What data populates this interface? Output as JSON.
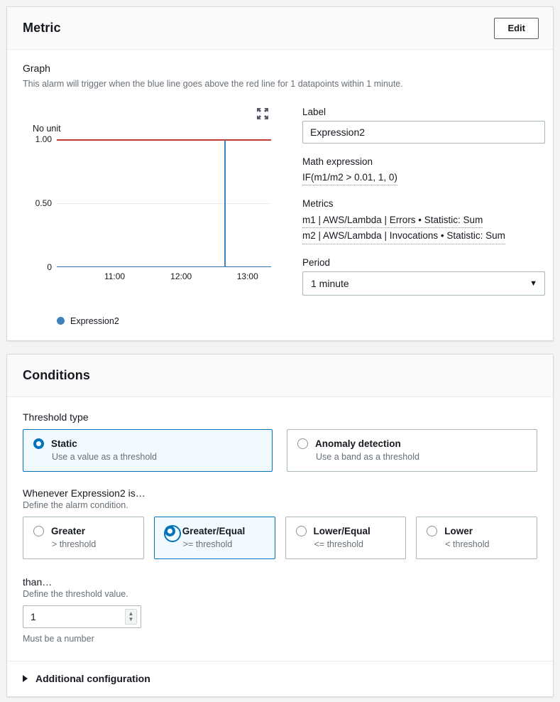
{
  "metric_card": {
    "title": "Metric",
    "edit_button": "Edit",
    "graph": {
      "heading": "Graph",
      "description": "This alarm will trigger when the blue line goes above the red line for 1 datapoints within 1 minute.",
      "expand_icon": "expand-icon",
      "unit_label": "No unit"
    },
    "fields": {
      "label_label": "Label",
      "label_value": "Expression2",
      "math_expression_label": "Math expression",
      "math_expression_value": "IF(m1/m2 > 0.01, 1, 0)",
      "metrics_label": "Metrics",
      "metrics_values": [
        "m1 | AWS/Lambda | Errors • Statistic: Sum",
        "m2 | AWS/Lambda | Invocations • Statistic: Sum"
      ],
      "period_label": "Period",
      "period_value": "1 minute"
    }
  },
  "chart_data": {
    "type": "line",
    "title": "",
    "xlabel": "",
    "ylabel": "No unit",
    "ylim": [
      0,
      1.0
    ],
    "yticks": [
      "1.00",
      "0.50",
      "0"
    ],
    "ytick_values": [
      1.0,
      0.5,
      0
    ],
    "xticks": [
      "11:00",
      "12:00",
      "13:00"
    ],
    "xtick_positions_pct": [
      27,
      58,
      89
    ],
    "grid": true,
    "legend": [
      {
        "name": "Expression2",
        "color": "#3d82bf"
      }
    ],
    "series": [
      {
        "name": "Expression2",
        "color": "#3d82bf",
        "x": [
          "10:30",
          "12:36",
          "12:37",
          "12:38",
          "13:30"
        ],
        "values": [
          0,
          0,
          1,
          0,
          0
        ]
      }
    ],
    "annotations": [
      {
        "type": "threshold-line",
        "label": "Threshold",
        "value": 1.0,
        "color": "#c03b2b"
      }
    ],
    "spike_position_pct": 78
  },
  "conditions_card": {
    "title": "Conditions",
    "threshold_type": {
      "label": "Threshold type",
      "options": [
        {
          "title": "Static",
          "desc": "Use a value as a threshold",
          "selected": true
        },
        {
          "title": "Anomaly detection",
          "desc": "Use a band as a threshold",
          "selected": false
        }
      ]
    },
    "whenever": {
      "label": "Whenever Expression2 is…",
      "desc": "Define the alarm condition.",
      "options": [
        {
          "title": "Greater",
          "desc": "> threshold",
          "selected": false
        },
        {
          "title": "Greater/Equal",
          "desc": ">= threshold",
          "selected": true
        },
        {
          "title": "Lower/Equal",
          "desc": "<= threshold",
          "selected": false
        },
        {
          "title": "Lower",
          "desc": "< threshold",
          "selected": false
        }
      ]
    },
    "than": {
      "label": "than…",
      "desc": "Define the threshold value.",
      "value": "1",
      "hint": "Must be a number"
    },
    "additional_configuration": "Additional configuration"
  },
  "colors": {
    "accent": "#0073bb",
    "series": "#3d82bf",
    "threshold": "#c03b2b",
    "page_bg": "#f2f3f3"
  }
}
